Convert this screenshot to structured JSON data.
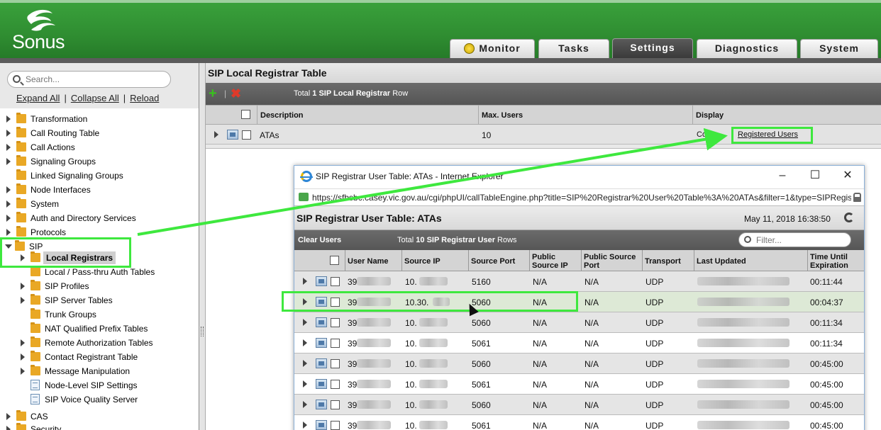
{
  "app": {
    "logo_text": "Sonus"
  },
  "tabs": [
    {
      "label": "Monitor"
    },
    {
      "label": "Tasks"
    },
    {
      "label": "Settings"
    },
    {
      "label": "Diagnostics"
    },
    {
      "label": "System"
    }
  ],
  "sidebar": {
    "search_placeholder": "Search...",
    "links": {
      "expand": "Expand All",
      "collapse": "Collapse All",
      "reload": "Reload"
    },
    "items": [
      {
        "label": "Transformation"
      },
      {
        "label": "Call Routing Table"
      },
      {
        "label": "Call Actions"
      },
      {
        "label": "Signaling Groups"
      },
      {
        "label": "Linked Signaling Groups"
      },
      {
        "label": "Node Interfaces"
      },
      {
        "label": "System"
      },
      {
        "label": "Auth and Directory Services"
      },
      {
        "label": "Protocols"
      },
      {
        "label": "SIP"
      },
      {
        "label": "Local Registrars"
      },
      {
        "label": "Local / Pass-thru Auth Tables"
      },
      {
        "label": "SIP Profiles"
      },
      {
        "label": "SIP Server Tables"
      },
      {
        "label": "Trunk Groups"
      },
      {
        "label": "NAT Qualified Prefix Tables"
      },
      {
        "label": "Remote Authorization Tables"
      },
      {
        "label": "Contact Registrant Table"
      },
      {
        "label": "Message Manipulation"
      },
      {
        "label": "Node-Level SIP Settings"
      },
      {
        "label": "SIP Voice Quality Server"
      },
      {
        "label": "CAS"
      },
      {
        "label": "Security"
      }
    ]
  },
  "main": {
    "title": "SIP Local Registrar Table",
    "toolbar": {
      "total_prefix": "Total ",
      "total_bold": "1 SIP Local Registrar",
      "total_suffix": " Row"
    },
    "columns": {
      "description": "Description",
      "max_users": "Max. Users",
      "display": "Display"
    },
    "row": {
      "description": "ATAs",
      "max_users": "10",
      "collapse": "Co...",
      "registered_users": "Registered Users"
    }
  },
  "popup": {
    "window_title": "SIP Registrar User Table: ATAs - Internet Explorer",
    "url": "https://sfbsbc.casey.vic.gov.au/cgi/phpUI/callTableEngine.php?title=SIP%20Registrar%20User%20Table%3A%20ATAs&filter=1&type=SIPRegis",
    "title": "SIP Registrar User Table: ATAs",
    "date": "May 11, 2018 16:38:50",
    "clear_users": "Clear Users",
    "total_prefix": "Total ",
    "total_bold": "10 SIP Registrar User",
    "total_suffix": " Rows",
    "filter_placeholder": "Filter...",
    "columns": {
      "user_name": "User Name",
      "source_ip": "Source IP",
      "source_port": "Source Port",
      "public_source_ip": "Public Source IP",
      "public_source_port": "Public Source Port",
      "transport": "Transport",
      "last_updated": "Last Updated",
      "time_until_expiration": "Time Until Expiration"
    },
    "rows": [
      {
        "user_name": "39",
        "source_ip": "10.",
        "source_port": "5160",
        "public_ip": "N/A",
        "public_port": "N/A",
        "transport": "UDP",
        "expiration": "00:11:44"
      },
      {
        "user_name": "39",
        "source_ip": "10.30.",
        "source_port": "5060",
        "public_ip": "N/A",
        "public_port": "N/A",
        "transport": "UDP",
        "expiration": "00:04:37"
      },
      {
        "user_name": "39",
        "source_ip": "10.",
        "source_port": "5060",
        "public_ip": "N/A",
        "public_port": "N/A",
        "transport": "UDP",
        "expiration": "00:11:34"
      },
      {
        "user_name": "39",
        "source_ip": "10.",
        "source_port": "5061",
        "public_ip": "N/A",
        "public_port": "N/A",
        "transport": "UDP",
        "expiration": "00:11:34"
      },
      {
        "user_name": "39",
        "source_ip": "10.",
        "source_port": "5060",
        "public_ip": "N/A",
        "public_port": "N/A",
        "transport": "UDP",
        "expiration": "00:45:00"
      },
      {
        "user_name": "39",
        "source_ip": "10.",
        "source_port": "5061",
        "public_ip": "N/A",
        "public_port": "N/A",
        "transport": "UDP",
        "expiration": "00:45:00"
      },
      {
        "user_name": "39",
        "source_ip": "10.",
        "source_port": "5060",
        "public_ip": "N/A",
        "public_port": "N/A",
        "transport": "UDP",
        "expiration": "00:45:00"
      },
      {
        "user_name": "39",
        "source_ip": "10.",
        "source_port": "5061",
        "public_ip": "N/A",
        "public_port": "N/A",
        "transport": "UDP",
        "expiration": "00:45:00"
      }
    ]
  },
  "colors": {
    "brand_green": "#2f8d31",
    "highlight_green": "#3ee83e"
  }
}
